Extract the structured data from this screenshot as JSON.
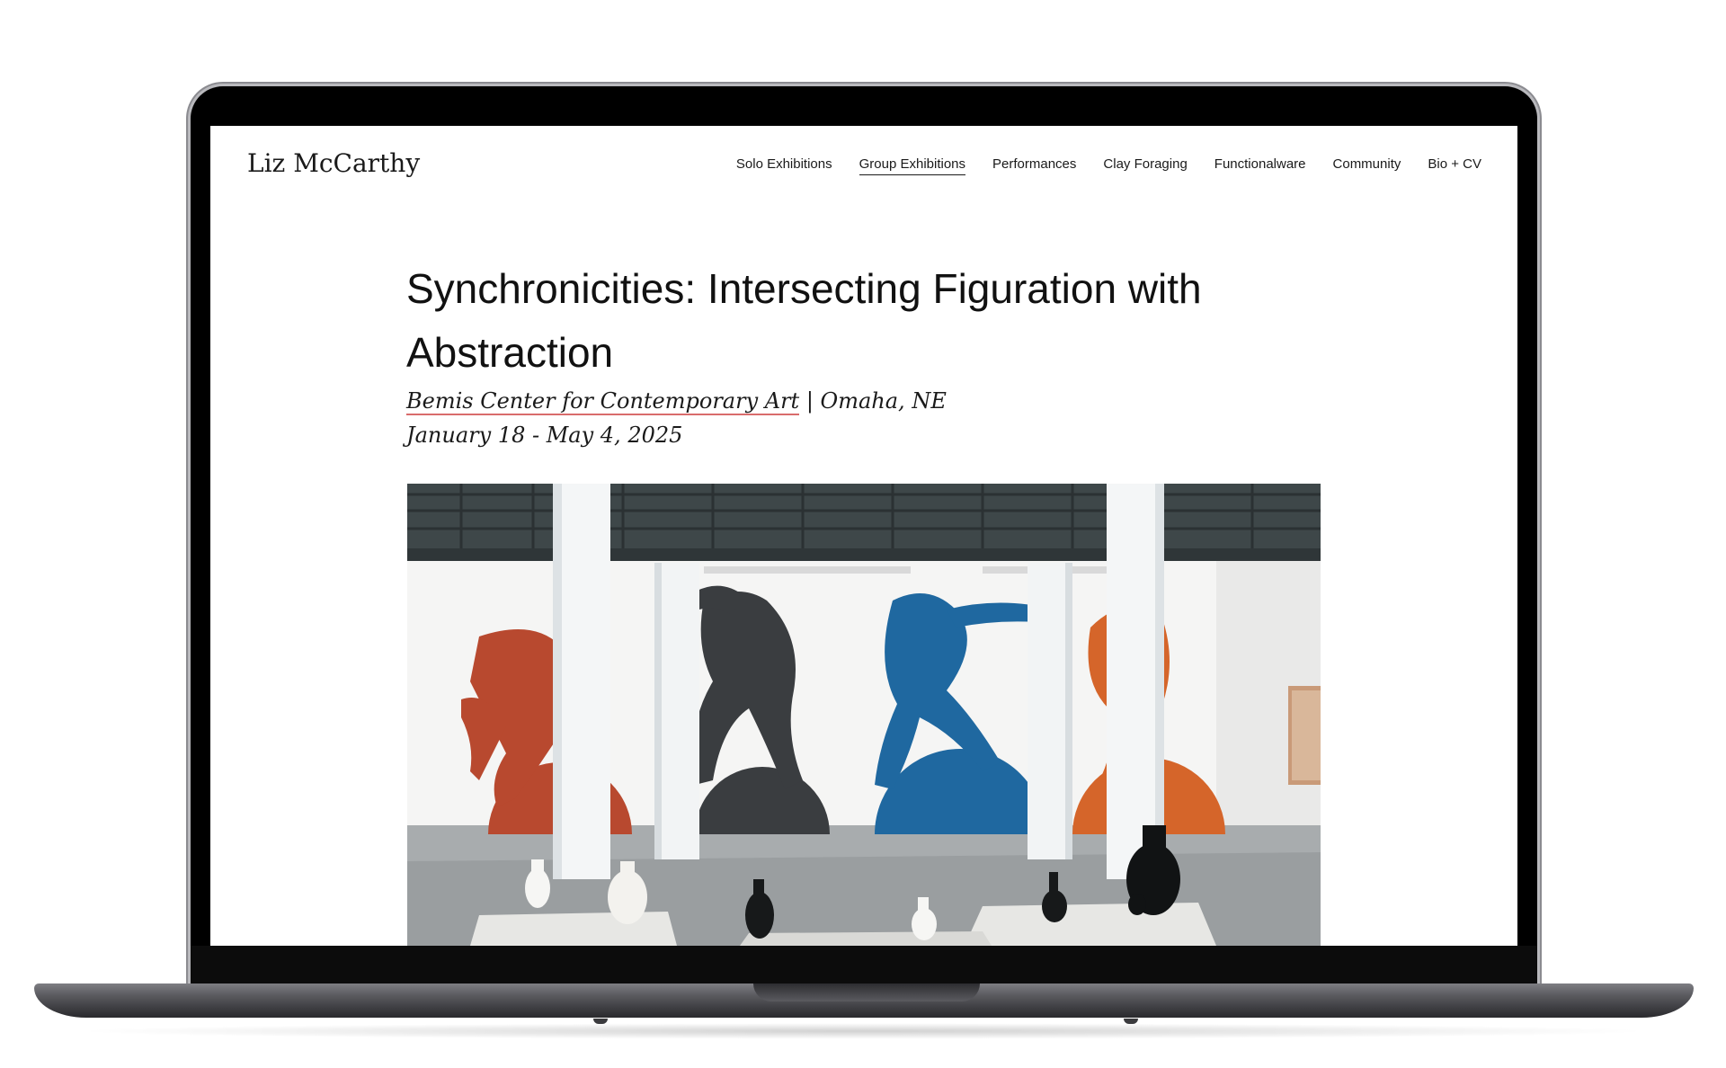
{
  "site": {
    "title": "Liz McCarthy"
  },
  "nav": {
    "items": [
      {
        "label": "Solo Exhibitions",
        "active": false
      },
      {
        "label": "Group Exhibitions",
        "active": true
      },
      {
        "label": "Performances",
        "active": false
      },
      {
        "label": "Clay Foraging",
        "active": false
      },
      {
        "label": "Functionalware",
        "active": false
      },
      {
        "label": "Community",
        "active": false
      },
      {
        "label": "Bio + CV",
        "active": false
      }
    ]
  },
  "exhibition": {
    "title": "Synchronicities: Intersecting Figuration with Abstraction",
    "venue": "Bemis Center for Contemporary Art",
    "separator": " | ",
    "location": "Omaha, NE",
    "dates": "January 18 - May 4, 2025"
  },
  "colors": {
    "link_underline": "#d96c6c",
    "mural_red": "#b8492f",
    "mural_charcoal": "#3a3d40",
    "mural_blue": "#1f68a0",
    "mural_orange": "#d5652a",
    "ceiling": "#3e4749"
  },
  "photo": {
    "icon": "gallery-installation-photo"
  }
}
